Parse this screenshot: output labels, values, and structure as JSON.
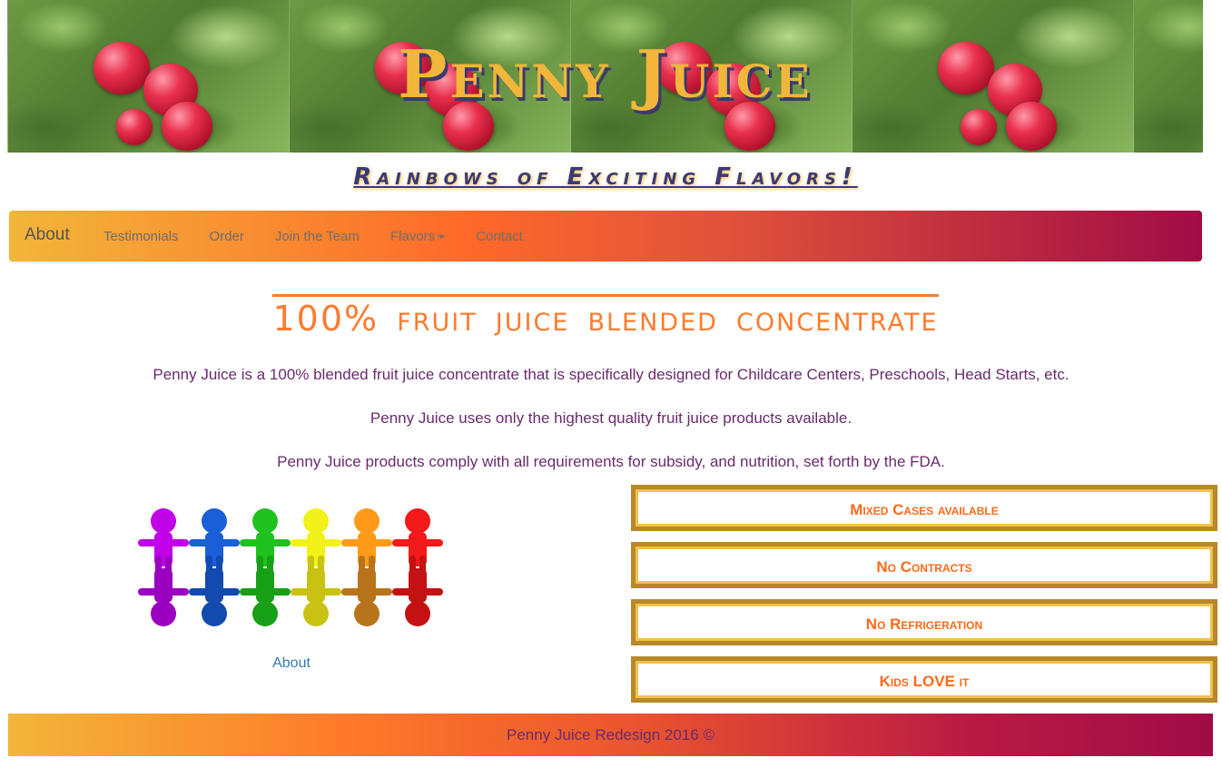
{
  "banner": {
    "title": "Penny Juice",
    "image": "apple-tree-banner"
  },
  "tagline": "Rainbows of Exciting Flavors!",
  "navbar": {
    "brand": "About",
    "links": [
      "Testimonials",
      "Order",
      "Join the Team",
      "Flavors",
      "Contact"
    ],
    "has_dropdown": "Flavors",
    "icons": {
      "dropdown": "caret-down-icon"
    }
  },
  "headline": "100% fruit juice blended concentrate",
  "intro": [
    "Penny Juice is a 100% blended fruit juice concentrate that is specifically designed for Childcare Centers, Preschools, Head Starts, etc.",
    "Penny Juice uses only the highest quality fruit juice products available.",
    "Penny Juice products comply with all requirements for subsidy, and nutrition, set forth by the FDA."
  ],
  "kids_image": {
    "icon": "rainbow-kids-image",
    "caption": "About"
  },
  "features": [
    "Mixed Cases available",
    "No Contracts",
    "No Refrigeration",
    "Kids LOVE it"
  ],
  "footer": "Penny Juice Redesign 2016 ©",
  "colors": {
    "accent_orange": "#ff7b2e",
    "title_gold": "#f2b63a",
    "text_purple": "#6a2a6e",
    "nav_end": "#a10c46",
    "box_gold": "#b8882b"
  }
}
